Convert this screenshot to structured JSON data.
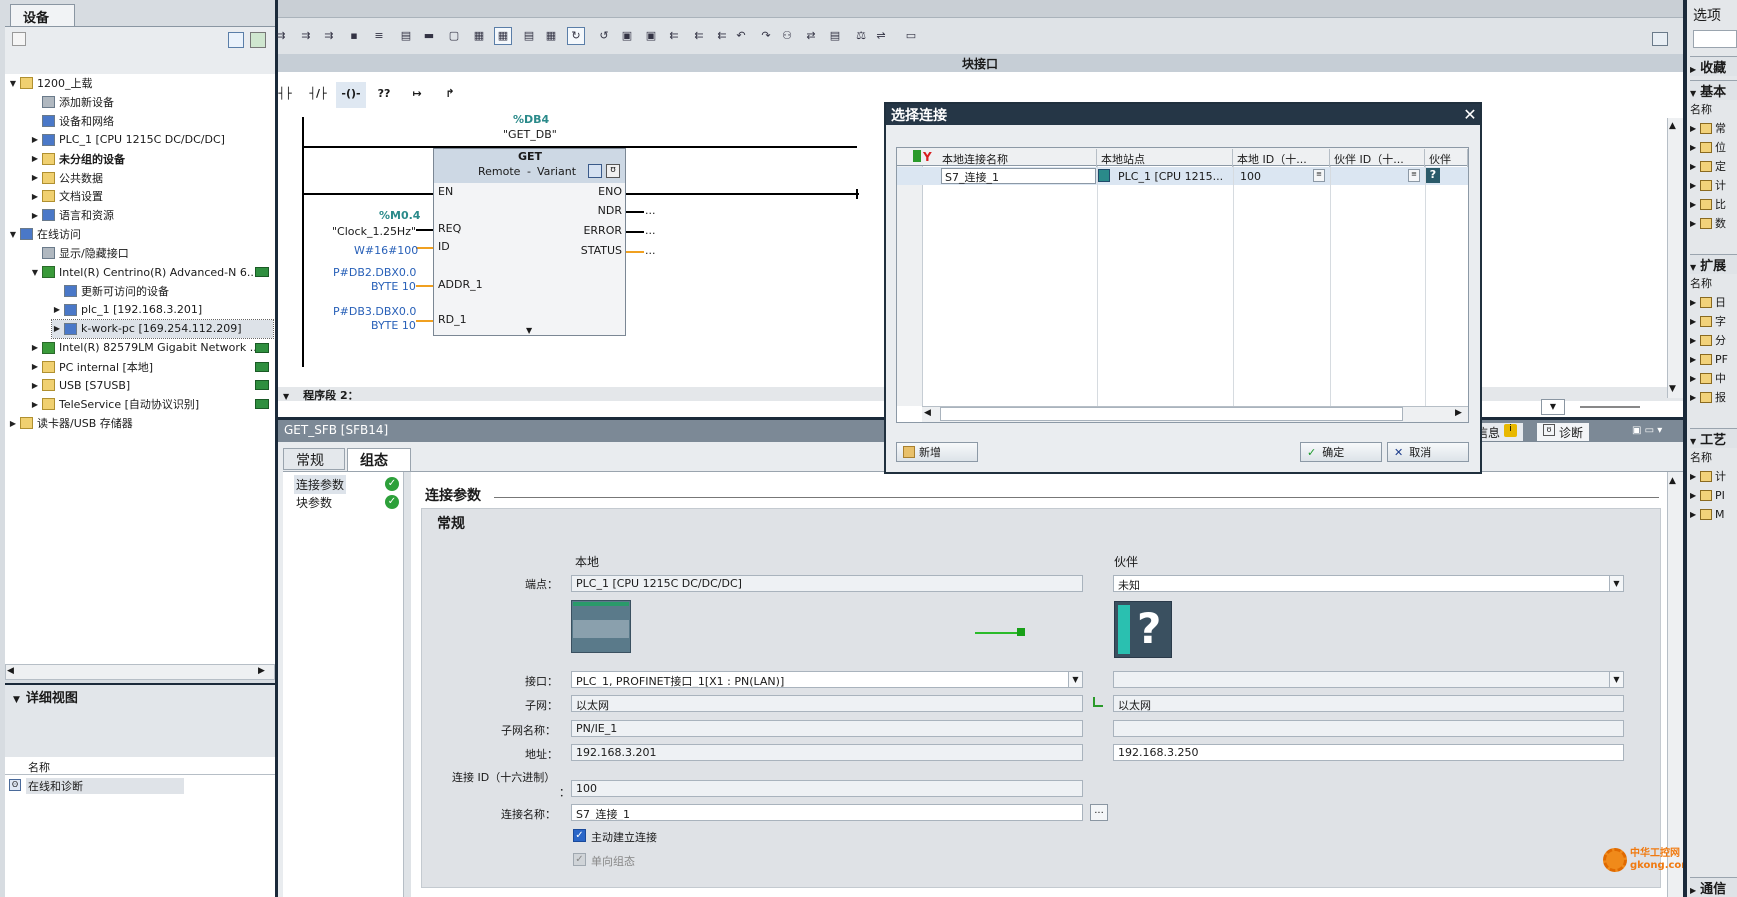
{
  "left_panel": {
    "tab": "设备",
    "tree": [
      {
        "label": "1200_上载",
        "indent": 0,
        "tri": "▼"
      },
      {
        "label": "添加新设备",
        "indent": 1,
        "tri": ""
      },
      {
        "label": "设备和网络",
        "indent": 1,
        "tri": ""
      },
      {
        "label": "PLC_1 [CPU 1215C DC/DC/DC]",
        "indent": 1,
        "tri": "▶"
      },
      {
        "label": "未分组的设备",
        "indent": 1,
        "tri": "▶"
      },
      {
        "label": "公共数据",
        "indent": 1,
        "tri": "▶"
      },
      {
        "label": "文档设置",
        "indent": 1,
        "tri": "▶"
      },
      {
        "label": "语言和资源",
        "indent": 1,
        "tri": "▶"
      },
      {
        "label": "在线访问",
        "indent": 0,
        "tri": "▼"
      },
      {
        "label": "显示/隐藏接口",
        "indent": 1,
        "tri": ""
      },
      {
        "label": "Intel(R) Centrino(R) Advanced-N 6...",
        "indent": 1,
        "tri": "▼"
      },
      {
        "label": "更新可访问的设备",
        "indent": 2,
        "tri": ""
      },
      {
        "label": "plc_1 [192.168.3.201]",
        "indent": 2,
        "tri": "▶"
      },
      {
        "label": "k-work-pc [169.254.112.209]",
        "indent": 2,
        "tri": "▶"
      },
      {
        "label": "Intel(R) 82579LM Gigabit Network ...",
        "indent": 1,
        "tri": "▶"
      },
      {
        "label": "PC internal [本地]",
        "indent": 1,
        "tri": "▶"
      },
      {
        "label": "USB [S7USB]",
        "indent": 1,
        "tri": "▶"
      },
      {
        "label": "TeleService [自动协议识别]",
        "indent": 1,
        "tri": "▶"
      },
      {
        "label": "读卡器/USB 存储器",
        "indent": 0,
        "tri": "▶"
      }
    ],
    "detail_title": "详细视图",
    "detail_col": "名称",
    "detail_row": "在线和诊断"
  },
  "editor": {
    "toolbar_title": "块接口",
    "lad_buttons": [
      "┤├",
      "┤/├",
      "-()-",
      "??",
      "↦",
      "↱"
    ],
    "block": {
      "db_addr": "%DB4",
      "db_name": "\"GET_DB\"",
      "name": "GET",
      "subtitle1": "Remote",
      "subtitle2": "-",
      "subtitle3": "Variant",
      "in_pins": [
        "EN",
        "REQ",
        "ID",
        "ADDR_1",
        "RD_1"
      ],
      "out_pins": [
        "ENO",
        "NDR",
        "ERROR",
        "STATUS"
      ],
      "out_dots": [
        "",
        "...",
        "...",
        "..."
      ],
      "req_addr": "%M0.4",
      "req_name": "\"Clock_1.25Hz\"",
      "id_val": "W#16#100",
      "addr1_a": "P#DB2.DBX0.0",
      "addr1_b": "BYTE 10",
      "rd1_a": "P#DB3.DBX0.0",
      "rd1_b": "BYTE 10"
    },
    "segment": "程序段 2："
  },
  "props": {
    "title": "GET_SFB [SFB14]",
    "tabs": [
      "常规",
      "组态"
    ],
    "nav": [
      "连接参数",
      "块参数"
    ],
    "section": "连接参数",
    "group": "常规",
    "col_local": "本地",
    "col_partner": "伙伴",
    "endpoint_label": "端点：",
    "endpoint_local": "PLC_1 [CPU 1215C DC/DC/DC]",
    "endpoint_partner": "未知",
    "interface_label": "接口：",
    "interface_local": "PLC_1, PROFINET接口_1[X1 : PN(LAN)]",
    "subnet_label": "子网：",
    "subnet_local": "以太网",
    "subnet_partner": "以太网",
    "subnet_name_label": "子网名称：",
    "subnet_name_local": "PN/IE_1",
    "addr_label": "地址：",
    "addr_local": "192.168.3.201",
    "addr_partner": "192.168.3.250",
    "connid_label": "连接 ID（十六进制）",
    "connid_colon": "：",
    "connid_value": "100",
    "connname_label": "连接名称：",
    "connname_value": "S7_连接_1",
    "browse": "...",
    "active_label": "主动建立连接",
    "oneway_label": "单向组态",
    "info_tab": "信息",
    "diag_tab": "诊断"
  },
  "dialog": {
    "title": "选择连接",
    "columns": [
      "本地连接名称",
      "本地站点",
      "本地 ID（十...",
      "伙伴 ID（十...",
      "伙伴"
    ],
    "row": [
      "S7_连接_1",
      "PLC_1 [CPU 1215...",
      "100",
      "",
      ""
    ],
    "new_btn": "新增",
    "ok_btn": "确定",
    "cancel_btn": "取消"
  },
  "right_panel": {
    "title": "选项",
    "sections": [
      "收藏",
      "基本",
      "扩展",
      "工艺",
      "通信"
    ],
    "name_col": "名称",
    "basic_items": [
      "常",
      "位",
      "定",
      "计",
      "比",
      "数"
    ],
    "ext_items": [
      "日",
      "字",
      "分",
      "PF",
      "中",
      "报"
    ],
    "tech_items": [
      "计",
      "PI",
      "M"
    ]
  },
  "watermark": "中华工控网 gkong.com"
}
